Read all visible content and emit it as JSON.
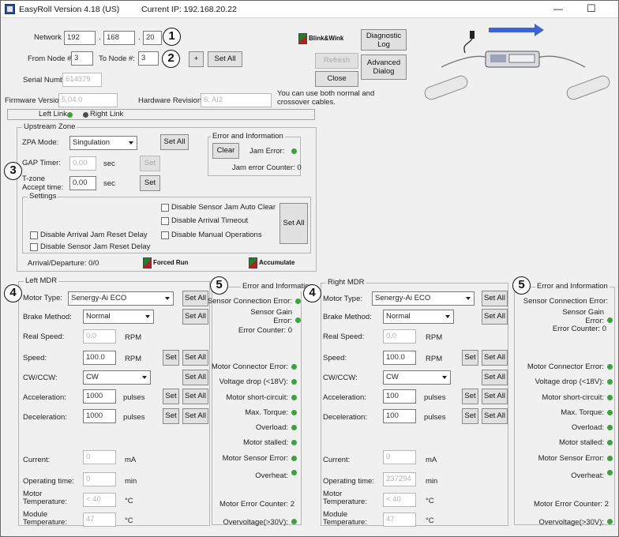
{
  "titlebar": {
    "app": "EasyRoll Version 4.18 (US)",
    "ip": "Current IP: 192.168.20.22",
    "min": "—",
    "max": "☐"
  },
  "network": {
    "ip_label": "Network IP:",
    "ip": [
      "192",
      "168",
      "20"
    ],
    "dot": ".",
    "from_label": "From Node #:",
    "from_value": "3",
    "to_label": "To Node #:",
    "to_value": "3",
    "plus": "+",
    "set_all": "Set All",
    "serial_label": "Serial Number:",
    "serial": "614379",
    "firmware_label": "Firmware Version:",
    "firmware": "5.04.0",
    "hardware_label": "Hardware Revision:",
    "hardware": "6, AI2"
  },
  "top_buttons": {
    "blink": "Blink&Wink",
    "diag": "Diagnostic Log",
    "refresh": "Refresh",
    "advanced": "Advanced Dialog",
    "close": "Close"
  },
  "note": "You can use both normal and crossover cables.",
  "links": {
    "left": "Left Link",
    "right": "Right Link"
  },
  "upstream": {
    "title": "Upstream Zone",
    "zpa_label": "ZPA Mode:",
    "zpa_value": "Singulation",
    "set_all": "Set All",
    "gap_label": "GAP Timer:",
    "gap_value": "0.00",
    "gap_unit": "sec",
    "gap_set": "Set",
    "tzone_label": "T-zone Accept time:",
    "tzone_value": "0.00",
    "tzone_unit": "sec",
    "tzone_set": "Set",
    "err_title": "Error and Information",
    "clear": "Clear",
    "jam_error": "Jam Error:",
    "jam_counter": "Jam error Counter: 0",
    "settings_title": "Settings",
    "opts": [
      "Disable Sensor Jam Auto Clear",
      "Disable Arrival Timeout",
      "Disable Arrival Jam Reset Delay",
      "Disable Manual Operations",
      "Disable Sensor Jam Reset Delay"
    ],
    "settings_set_all": "Set All",
    "arrival": "Arrival/Departure: 0/0",
    "forced_run": "Forced Run",
    "accumulate": "Accumulate"
  },
  "left_mdr": {
    "title": "Left MDR",
    "motor_type_label": "Motor Type:",
    "motor_type": "Senergy-Ai ECO",
    "brake_label": "Brake Method:",
    "brake": "Normal",
    "real_speed_label": "Real Speed:",
    "real_speed": "0.0",
    "real_speed_unit": "RPM",
    "speed_label": "Speed:",
    "speed": "100.0",
    "speed_unit": "RPM",
    "cw_label": "CW/CCW:",
    "cw": "CW",
    "accel_label": "Acceleration:",
    "accel": "1000",
    "accel_unit": "pulses",
    "decel_label": "Deceleration:",
    "decel": "1000",
    "decel_unit": "pulses",
    "current_label": "Current:",
    "current": "0",
    "current_unit": "mA",
    "optime_label": "Operating time:",
    "optime": "0",
    "optime_unit": "min",
    "mtemp_label": "Motor Temperature:",
    "mtemp": "< 40",
    "mtemp_unit": "°C",
    "modtemp_label": "Module Temperature:",
    "modtemp": "47",
    "modtemp_unit": "°C",
    "set": "Set",
    "set_all": "Set All"
  },
  "left_info": {
    "title": "Error and Information",
    "sensor_conn": "Sensor Connection Error:",
    "sensor_gain": "Sensor Gain Error:",
    "err_counter": "Error Counter: 0",
    "motor_conn": "Motor Connector Error:",
    "vdrop": "Voltage drop (<18V):",
    "short": "Motor short-circuit:",
    "torque": "Max. Torque:",
    "overload": "Overload:",
    "stalled": "Motor stalled:",
    "motor_sensor": "Motor Sensor Error:",
    "overheat": "Overheat:",
    "motor_counter": "Motor Error Counter: 2",
    "overvolt": "Overvoltage(>30V):"
  },
  "right_mdr": {
    "title": "Right MDR",
    "motor_type": "Senergy-Ai ECO",
    "brake": "Normal",
    "real_speed": "0.0",
    "speed": "100.0",
    "cw": "CW",
    "accel": "100",
    "decel": "100",
    "current": "0",
    "optime": "237294",
    "mtemp": "< 40",
    "modtemp": "47"
  },
  "right_info": {
    "motor_counter": "Motor Error Counter: 2"
  },
  "badges": [
    "1",
    "2",
    "3",
    "4",
    "4",
    "5",
    "5"
  ]
}
